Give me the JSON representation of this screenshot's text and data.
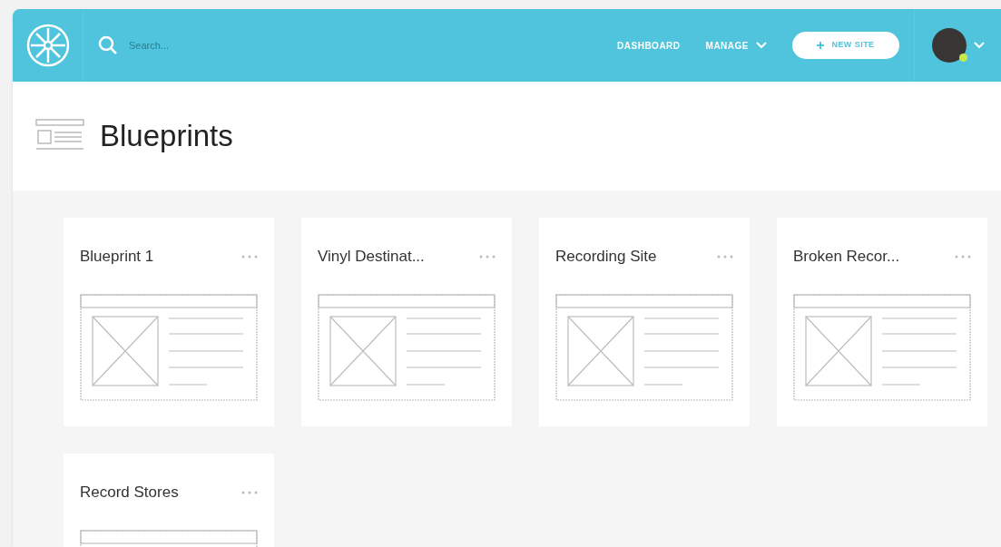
{
  "topbar": {
    "search": {
      "placeholder": "Search..."
    },
    "nav": [
      {
        "label": "DASHBOARD",
        "dropdown": false
      },
      {
        "label": "MANAGE",
        "dropdown": true
      }
    ],
    "new_button": "NEW SITE",
    "user": {
      "online": true
    }
  },
  "page": {
    "title": "Blueprints"
  },
  "cards": [
    {
      "title": "Blueprint 1"
    },
    {
      "title": "Vinyl Destinat..."
    },
    {
      "title": "Recording Site"
    },
    {
      "title": "Broken Recor..."
    },
    {
      "title": "Record Stores"
    }
  ]
}
